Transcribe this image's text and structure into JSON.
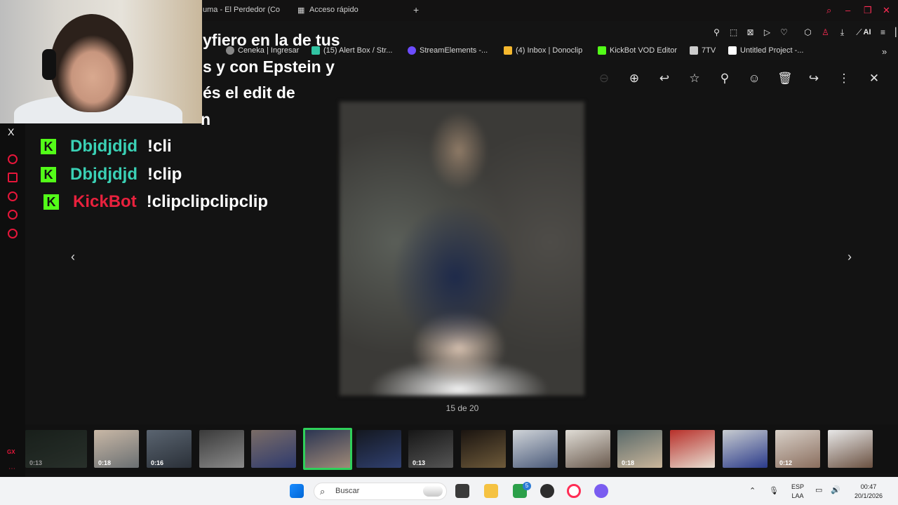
{
  "browser": {
    "tab_label": "uma - El Perdedor (Co",
    "quick_access_label": "Acceso rápido",
    "new_tab": "+"
  },
  "bookmarks": [
    {
      "label": "Ceneka | Ingresar",
      "color": "#888888"
    },
    {
      "label": "(15) Alert Box / Str...",
      "color": "#31c3a2"
    },
    {
      "label": "StreamElements -...",
      "color": "#6c4cff"
    },
    {
      "label": "(4) Inbox | Donoclip",
      "color": "#f5b82e"
    },
    {
      "label": "KickBot VOD Editor",
      "color": "#53fc18"
    },
    {
      "label": "7TV",
      "color": "#cccccc"
    },
    {
      "label": "Untitled Project -...",
      "color": "#ffffff"
    }
  ],
  "toolbar_ai_label": "AI",
  "overlay_lines": [
    "yfiero en la de tus",
    "s y con Epstein y",
    "és el edit de",
    "n"
  ],
  "chat": [
    {
      "user": "Dbjdjdjd",
      "message": "!cli",
      "user_color": "#3ad1b5"
    },
    {
      "user": "Dbjdjdjd",
      "message": "!clip",
      "user_color": "#3ad1b5"
    },
    {
      "user": "KickBot",
      "message": "!clipclipclipclip",
      "user_color": "#e8213d"
    }
  ],
  "viewer": {
    "counter": "15 de 20",
    "close": "✕"
  },
  "thumbnails": [
    {
      "duration": "0:13",
      "colors": [
        "#1e2a22",
        "#3c4a40"
      ]
    },
    {
      "duration": "0:18",
      "colors": [
        "#c9b8a6",
        "#6a6f72"
      ]
    },
    {
      "duration": "0:16",
      "colors": [
        "#5a6470",
        "#2a3038"
      ]
    },
    {
      "duration": "",
      "colors": [
        "#3a3a3a",
        "#8a8a8a"
      ]
    },
    {
      "duration": "",
      "colors": [
        "#7a6c66",
        "#2e3a6e"
      ]
    },
    {
      "duration": "",
      "colors": [
        "#2b3552",
        "#a08a78"
      ]
    },
    {
      "duration": "",
      "colors": [
        "#141820",
        "#304070"
      ]
    },
    {
      "duration": "0:13",
      "colors": [
        "#161616",
        "#555555"
      ]
    },
    {
      "duration": "",
      "colors": [
        "#1a1410",
        "#6e5a3a"
      ]
    },
    {
      "duration": "",
      "colors": [
        "#d0d4d8",
        "#4a5a7a"
      ]
    },
    {
      "duration": "",
      "colors": [
        "#e0ddd6",
        "#6a5a4e"
      ]
    },
    {
      "duration": "0:18",
      "colors": [
        "#5a6a6a",
        "#c9b59a"
      ]
    },
    {
      "duration": "",
      "colors": [
        "#b8302a",
        "#e8e0d4"
      ]
    },
    {
      "duration": "",
      "colors": [
        "#c8ccd0",
        "#2a3a8a"
      ]
    },
    {
      "duration": "0:12",
      "colors": [
        "#d8d0c8",
        "#8a6e5e"
      ]
    },
    {
      "duration": "",
      "colors": [
        "#e8e8e8",
        "#6a5040"
      ]
    }
  ],
  "taskbar": {
    "search_placeholder": "Buscar",
    "lang_top": "ESP",
    "lang_bottom": "LAA",
    "time": "00:47",
    "date": "20/1/2026",
    "badge_count": "5"
  },
  "colors": {
    "accent": "#ff2d55",
    "kick_green": "#53fc18",
    "selection_green": "#2fd05a"
  }
}
